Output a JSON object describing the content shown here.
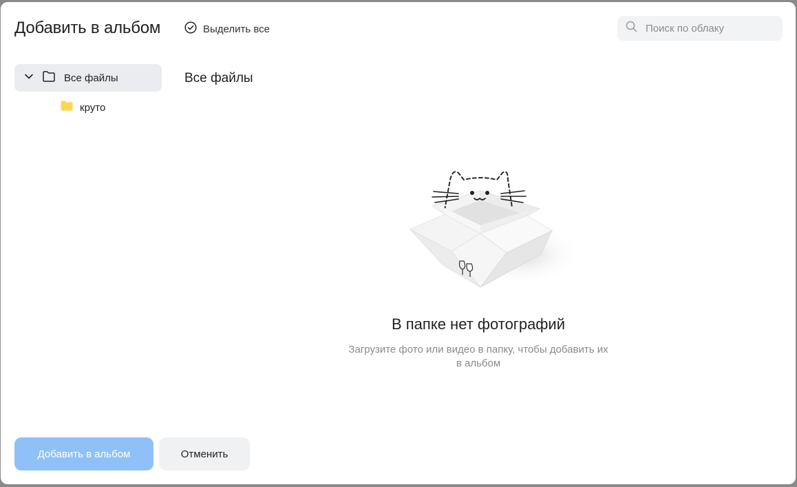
{
  "dialog": {
    "title": "Добавить в альбом",
    "select_all_label": "Выделить все",
    "search_placeholder": "Поиск по облаку"
  },
  "sidebar": {
    "root": {
      "label": "Все файлы",
      "icon": "folder-outline-icon",
      "expanded": true
    },
    "children": [
      {
        "label": "круто",
        "icon": "folder-filled-icon",
        "color": "#ffd54f"
      }
    ]
  },
  "main": {
    "section_title": "Все файлы",
    "empty_title": "В папке нет фотографий",
    "empty_subtitle": "Загрузите фото или видео в папку, чтобы добавить их в альбом",
    "illustration": "cat-in-box-illustration"
  },
  "footer": {
    "primary_label": "Добавить в альбом",
    "primary_disabled": true,
    "secondary_label": "Отменить"
  },
  "colors": {
    "primary": "#8fc0f8",
    "folder": "#ffd54f",
    "selected_bg": "#ebecef"
  }
}
